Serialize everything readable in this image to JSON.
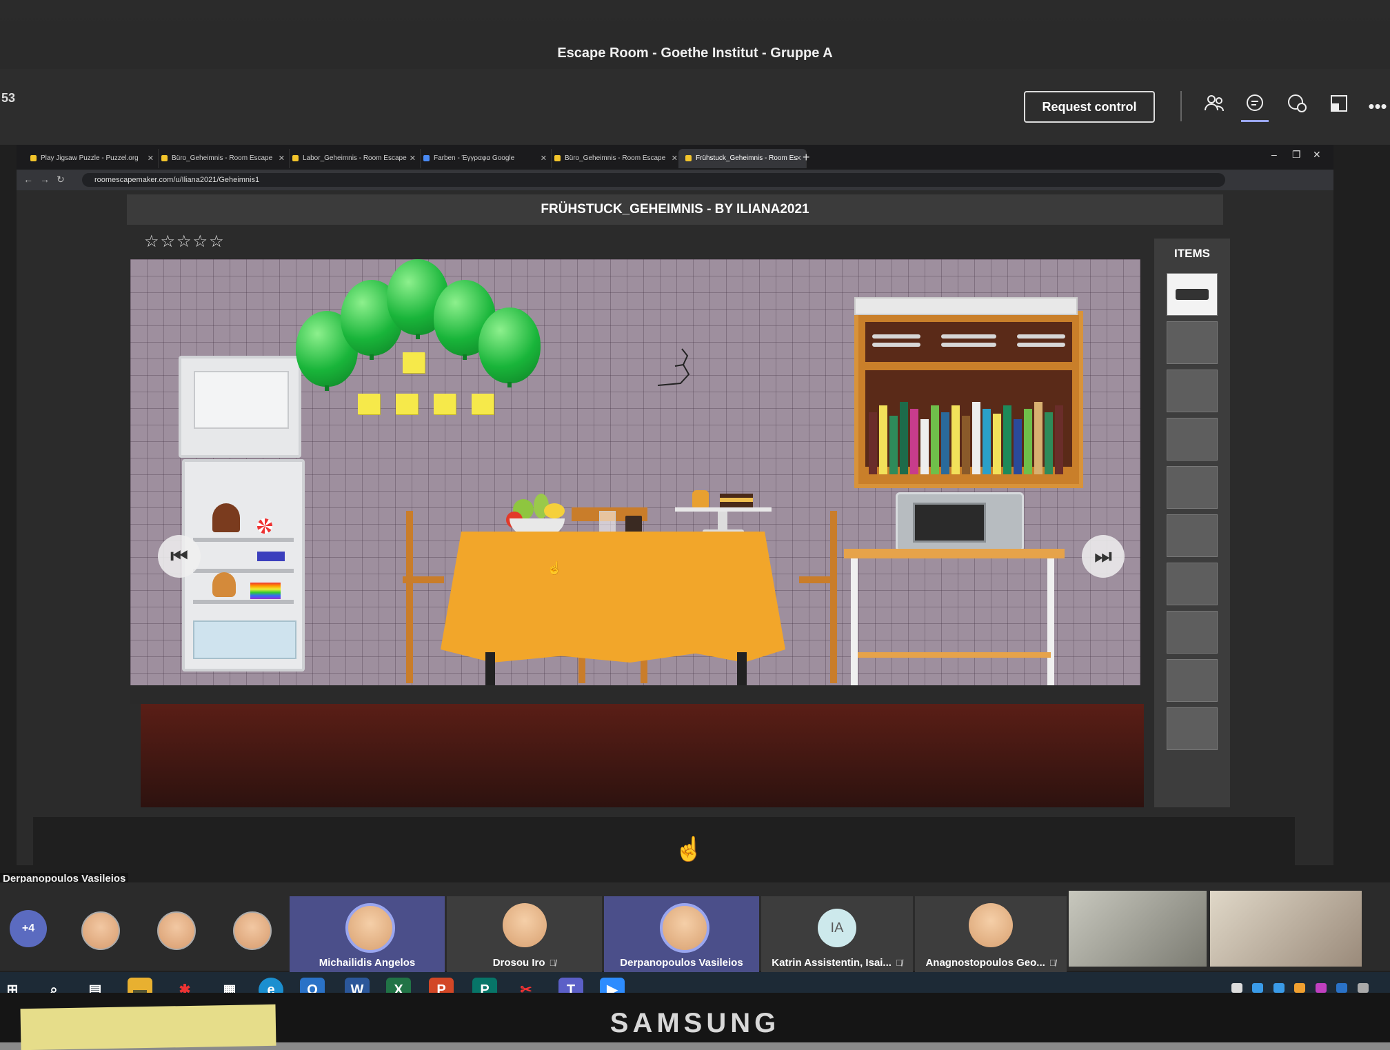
{
  "teams": {
    "window_title": "Escape Room - Goethe Institut - Gruppe A",
    "timer_partial": "53",
    "request_control_label": "Request control"
  },
  "browser": {
    "tabs": [
      {
        "label": "Play Jigsaw Puzzle - Puzzel.org",
        "active": false
      },
      {
        "label": "Büro_Geheimnis - Room Escape",
        "active": false
      },
      {
        "label": "Labor_Geheimnis - Room Escape",
        "active": false
      },
      {
        "label": "Farben - Έγγραφα Google",
        "active": false
      },
      {
        "label": "Büro_Geheimnis - Room Escape",
        "active": false
      },
      {
        "label": "Frühstuck_Geheimnis - Room Es",
        "active": true
      }
    ],
    "url": "roomescapemaker.com/u/Iliana2021/Geheimnis1"
  },
  "game": {
    "title": "FRÜHSTUCK_GEHEIMNIS - BY ILIANA2021",
    "rating_stars": "☆☆☆☆☆",
    "items_label": "ITEMS",
    "inventory": [
      "cassette-tape",
      "",
      "",
      "",
      "",
      "",
      "",
      "",
      "",
      ""
    ],
    "prev_arrow": "⏮",
    "next_arrow": "⏭"
  },
  "meeting": {
    "speaker_flag": "Derpanopoulos Vasileios",
    "more_count": "+4",
    "participants": [
      {
        "name": "Michailidis Angelos",
        "muted": false,
        "type": "photo"
      },
      {
        "name": "Drosou Iro",
        "muted": true,
        "type": "photo"
      },
      {
        "name": "Derpanopoulos Vasileios",
        "muted": false,
        "type": "photo"
      },
      {
        "name": "Katrin Assistentin, Isai...",
        "muted": true,
        "type": "initials",
        "initials": "IA"
      },
      {
        "name": "Anagnostopoulos Geo...",
        "muted": true,
        "type": "photo"
      }
    ]
  },
  "monitor_brand": "SAMSUNG",
  "colors": {
    "tablecloth": "#f2a62a",
    "balloon": "#19b53a",
    "wall": "#9e8f9e",
    "teams_accent": "#5b6bc0"
  }
}
